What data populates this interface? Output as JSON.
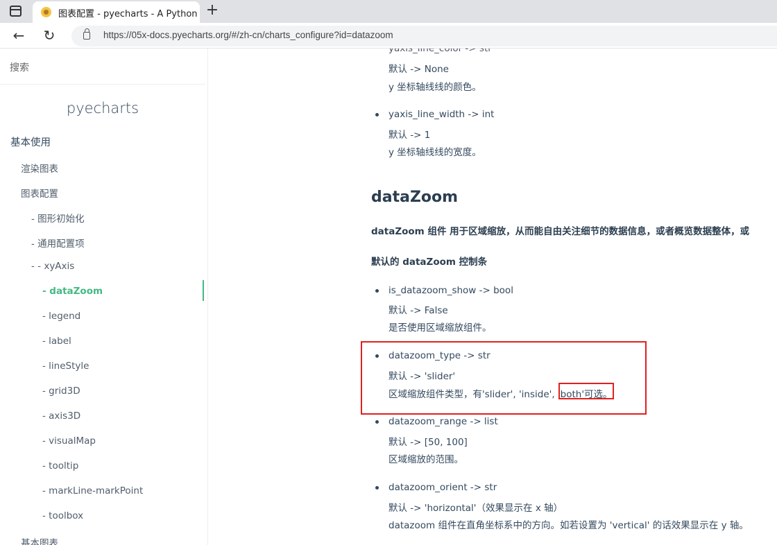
{
  "browser": {
    "tab_title": "图表配置 - pyecharts - A Python",
    "url": "https://05x-docs.pyecharts.org/#/zh-cn/charts_configure?id=datazoom",
    "new_tab": "+",
    "back": "←",
    "reload": "↻"
  },
  "sidebar": {
    "search_placeholder": "搜索",
    "app_name": "pyecharts",
    "items": [
      {
        "label": "基本使用"
      },
      {
        "label": "渲染图表"
      },
      {
        "label": "图表配置"
      },
      {
        "label": "- 图形初始化"
      },
      {
        "label": "- 通用配置项"
      },
      {
        "label": "-   - xyAxis"
      },
      {
        "label": "- dataZoom"
      },
      {
        "label": "- legend"
      },
      {
        "label": "- label"
      },
      {
        "label": "- lineStyle"
      },
      {
        "label": "- grid3D"
      },
      {
        "label": "- axis3D"
      },
      {
        "label": "- visualMap"
      },
      {
        "label": "- tooltip"
      },
      {
        "label": "- markLine-markPoint"
      },
      {
        "label": "- toolbox"
      },
      {
        "label": "基本图表"
      }
    ]
  },
  "content": {
    "partial_top": "yaxis_line_color -> str",
    "yaxis_color": {
      "default": "默认 -> None",
      "desc": "y 坐标轴线线的颜色。"
    },
    "yaxis_width": {
      "name": "yaxis_line_width -> int",
      "default": "默认 -> 1",
      "desc": "y 坐标轴线线的宽度。"
    },
    "heading": "dataZoom",
    "intro": "dataZoom 组件 用于区域缩放，从而能自由关注细节的数据信息，或者概览数据整体，或",
    "subheading": "默认的 dataZoom 控制条",
    "params": [
      {
        "name": "is_datazoom_show -> bool",
        "default": "默认 -> False",
        "desc": "是否使用区域缩放组件。"
      },
      {
        "name": "datazoom_type -> str",
        "default": "默认 -> 'slider'",
        "desc_a": "区域缩放组件类型，有'slider', 'inside', ",
        "desc_b": "'both'可选。"
      },
      {
        "name": "datazoom_range -> list",
        "default": "默认 -> [50, 100]",
        "desc": "区域缩放的范围。"
      },
      {
        "name": "datazoom_orient -> str",
        "default": "默认 -> 'horizontal'（效果显示在 x 轴）",
        "desc": "datazoom 组件在直角坐标系中的方向。如若设置为 'vertical' 的话效果显示在 y 轴。"
      }
    ]
  },
  "colors": {
    "accent": "#42b983",
    "annotation": "#e0201f",
    "text": "#34495e"
  }
}
